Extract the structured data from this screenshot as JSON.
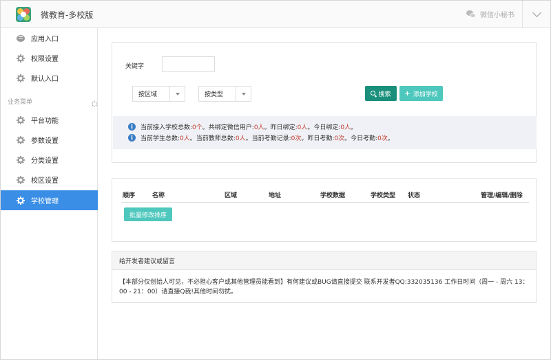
{
  "header": {
    "app_title": "微教育-多校版",
    "wechat_label": "微信小秘书"
  },
  "sidebar": {
    "top_items": [
      {
        "label": "应用入口",
        "icon": "chat-bubble-icon"
      },
      {
        "label": "权限设置",
        "icon": "gear-icon"
      },
      {
        "label": "默认入口",
        "icon": "gear-icon"
      }
    ],
    "section_label": "业务菜单",
    "menu_items": [
      {
        "label": "平台功能",
        "icon": "gear-icon"
      },
      {
        "label": "参数设置",
        "icon": "gear-icon"
      },
      {
        "label": "分类设置",
        "icon": "gear-icon"
      },
      {
        "label": "校区设置",
        "icon": "gear-icon"
      },
      {
        "label": "学校管理",
        "icon": "gear-icon",
        "active": true
      }
    ],
    "active_color": "#3a8ee6"
  },
  "search": {
    "keyword_label": "关键字",
    "keyword_value": "",
    "region_select": "按区域",
    "type_select": "按类型",
    "search_button": "搜索",
    "add_button": "添加学校",
    "search_color": "#1a8f7c",
    "add_color": "#4ec7bd"
  },
  "info": {
    "line1": {
      "t1": "当前接入学校总数:",
      "v1": "0个",
      "t2": "。共绑定微信用户:",
      "v2": "0人",
      "t3": "。昨日绑定:",
      "v3": "0人",
      "t4": "。今日绑定:",
      "v4": "0人",
      "t5": "。"
    },
    "line2": {
      "t1": "当前学生总数:",
      "v1": "0人",
      "t2": "。当前教师总数:",
      "v2": "0人",
      "t3": "。当前考勤记录:",
      "v3": "0次",
      "t4": "。昨日考勤:",
      "v4": "0次",
      "t5": "。今日考勤:",
      "v5": "0次",
      "t6": "。"
    }
  },
  "table": {
    "columns": [
      "顺序",
      "名称",
      "区域",
      "地址",
      "学校数据",
      "学校类型",
      "状态",
      "管理/编辑/删除"
    ],
    "batch_button": "批量修改排序"
  },
  "feedback": {
    "title": "给开发者建议或留言",
    "body": "【本部分仅创始人可见，不必担心客户或其他管理员能看到】有何建议或BUG请直接提交 联系开发者QQ:332035136 工作日时间（周一 - 周六 13：00 - 21：00）请直接Q我!其他时间勿扰。"
  }
}
